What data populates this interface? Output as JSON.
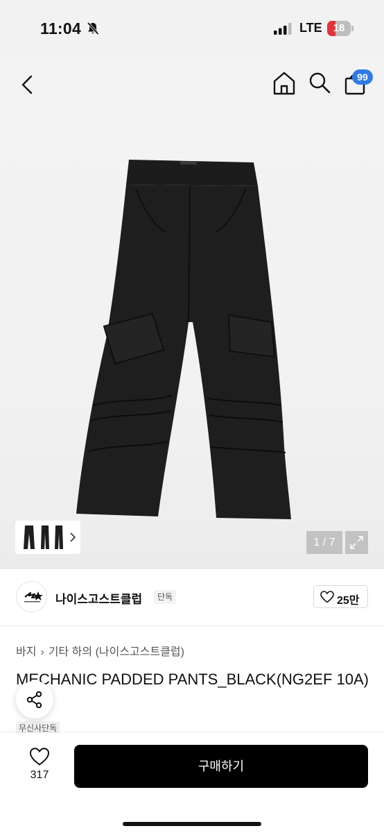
{
  "status_bar": {
    "time": "11:04",
    "network": "LTE",
    "battery": "18"
  },
  "header": {
    "cart_count": "99"
  },
  "gallery": {
    "page_indicator": "1 / 7"
  },
  "brand": {
    "name": "나이스고스트클럽",
    "tag": "단독",
    "like_count": "25만"
  },
  "breadcrumb": {
    "category": "바지",
    "subcategory": "기타 하의",
    "brand": "(나이스고스트클럽)"
  },
  "product": {
    "title": "MECHANIC PADDED PANTS_BLACK(NG2EF 10A)",
    "badge": "무신사단독"
  },
  "bottom_bar": {
    "wish_count": "317",
    "buy_label": "구매하기"
  },
  "colors": {
    "badge_blue": "#2f7be5",
    "battery_red": "#e0343a",
    "buy_button": "#000000"
  }
}
